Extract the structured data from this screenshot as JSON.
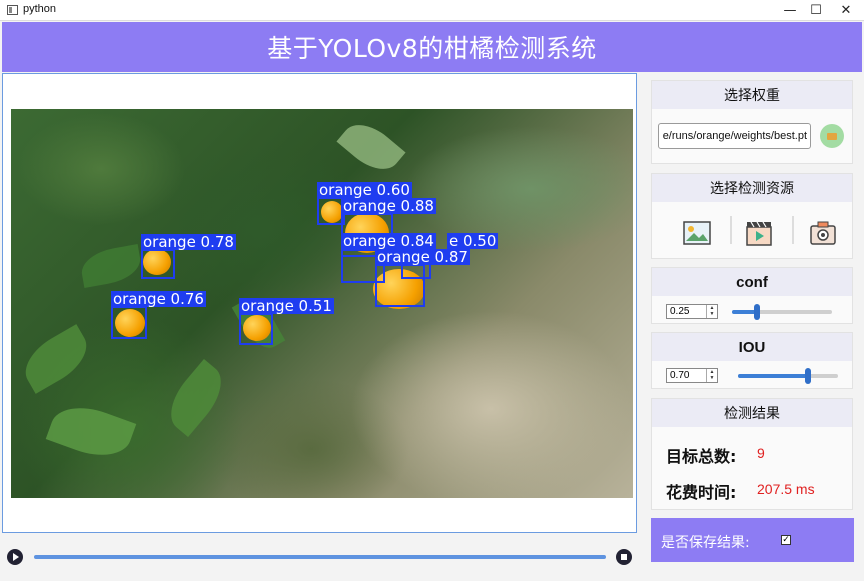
{
  "window": {
    "title": "python",
    "min_glyph": "—",
    "max_glyph": "☐",
    "close_glyph": "✕"
  },
  "header": {
    "title": "基于YOLOv8的柑橘检测系统"
  },
  "detections": [
    {
      "label": "orange 0.60"
    },
    {
      "label": "orange 0.88"
    },
    {
      "label": "orange 0.78"
    },
    {
      "label": "orange 0.84"
    },
    {
      "label": "e 0.50"
    },
    {
      "label": "orange 0.87"
    },
    {
      "label": "orange 0.76"
    },
    {
      "label": "orange 0.51"
    }
  ],
  "weights_panel": {
    "title": "选择权重",
    "path": "e/runs/orange/weights/best.pt"
  },
  "source_panel": {
    "title": "选择检测资源",
    "icons": [
      "image-icon",
      "video-icon",
      "camera-icon"
    ]
  },
  "conf_panel": {
    "title": "conf",
    "value": "0.25",
    "level": 0.25
  },
  "iou_panel": {
    "title": "IOU",
    "value": "0.70",
    "level": 0.7
  },
  "results_panel": {
    "title": "检测结果",
    "count_label": "目标总数:",
    "count_value": "9",
    "time_label": "花费时间:",
    "time_value": "207.5 ms"
  },
  "save": {
    "label": "是否保存结果:",
    "checked_glyph": "✓"
  },
  "colors": {
    "accent": "#8d7cf3",
    "detect_box": "#1f3df0",
    "result_value": "#e02020",
    "slider": "#3c7fd6"
  }
}
